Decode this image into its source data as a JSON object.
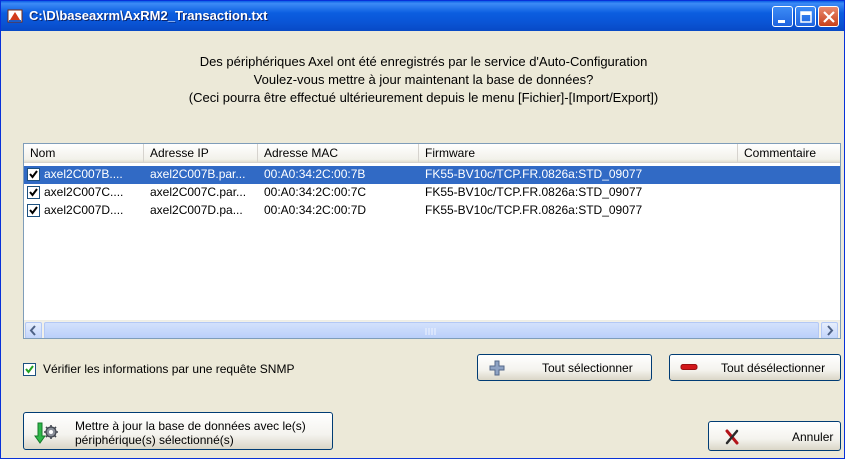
{
  "window": {
    "title": "C:\\D\\baseaxrm\\AxRM2_Transaction.txt",
    "icons": {
      "app": "app-window-icon",
      "minimize": "minimize-icon",
      "maximize": "maximize-icon",
      "close": "close-icon"
    }
  },
  "message": {
    "line1": "Des périphériques Axel ont été enregistrés par le service d'Auto-Configuration",
    "line2": "Voulez-vous mettre à jour maintenant la base de données?",
    "line3": "(Ceci pourra être effectué ultérieurement depuis le menu [Fichier]-[Import/Export])"
  },
  "table": {
    "columns": [
      "Nom",
      "Adresse IP",
      "Adresse MAC",
      "Firmware",
      "Commentaire"
    ],
    "rows": [
      {
        "checked": true,
        "selected": true,
        "nom": "axel2C007B....",
        "ip": "axel2C007B.par...",
        "mac": "00:A0:34:2C:00:7B",
        "firmware": "FK55-BV10c/TCP.FR.0826a:STD_09077",
        "commentaire": ""
      },
      {
        "checked": true,
        "selected": false,
        "nom": "axel2C007C....",
        "ip": "axel2C007C.par...",
        "mac": "00:A0:34:2C:00:7C",
        "firmware": "FK55-BV10c/TCP.FR.0826a:STD_09077",
        "commentaire": ""
      },
      {
        "checked": true,
        "selected": false,
        "nom": "axel2C007D....",
        "ip": "axel2C007D.pa...",
        "mac": "00:A0:34:2C:00:7D",
        "firmware": "FK55-BV10c/TCP.FR.0826a:STD_09077",
        "commentaire": ""
      }
    ]
  },
  "snmp": {
    "checked": true,
    "label": "Vérifier les informations par une requête SNMP"
  },
  "buttons": {
    "select_all": "Tout sélectionner",
    "deselect_all": "Tout désélectionner",
    "update_line1": "Mettre à jour la base de données avec le(s)",
    "update_line2": "périphérique(s) sélectionné(s)",
    "cancel": "Annuler"
  },
  "colors": {
    "selection": "#316AC5",
    "titlebar": "#0A55D6",
    "dialog_bg": "#ECE9D8"
  }
}
